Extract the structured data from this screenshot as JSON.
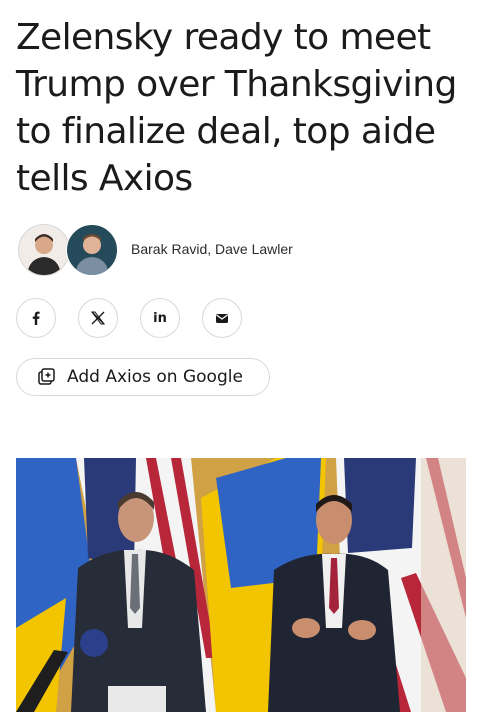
{
  "article": {
    "headline": "Zelensky ready to meet Trump over Thanksgiving to finalize deal, top aide tells Axios",
    "authors": "Barak Ravid, Dave Lawler"
  },
  "share": {
    "buttons": [
      {
        "network": "facebook",
        "icon": "facebook-icon"
      },
      {
        "network": "x",
        "icon": "x-icon"
      },
      {
        "network": "linkedin",
        "icon": "linkedin-icon",
        "label": "in"
      },
      {
        "network": "email",
        "icon": "email-icon"
      }
    ]
  },
  "google_button": {
    "label": "Add Axios on Google",
    "icon": "add-source-icon"
  },
  "photo": {
    "subject": "two men in suits in front of Ukrainian and US flags"
  },
  "colors": {
    "ukraine_blue": "#2f63c4",
    "ukraine_yellow": "#f2c500",
    "us_red": "#b8263a",
    "us_blue": "#2a3a78"
  }
}
